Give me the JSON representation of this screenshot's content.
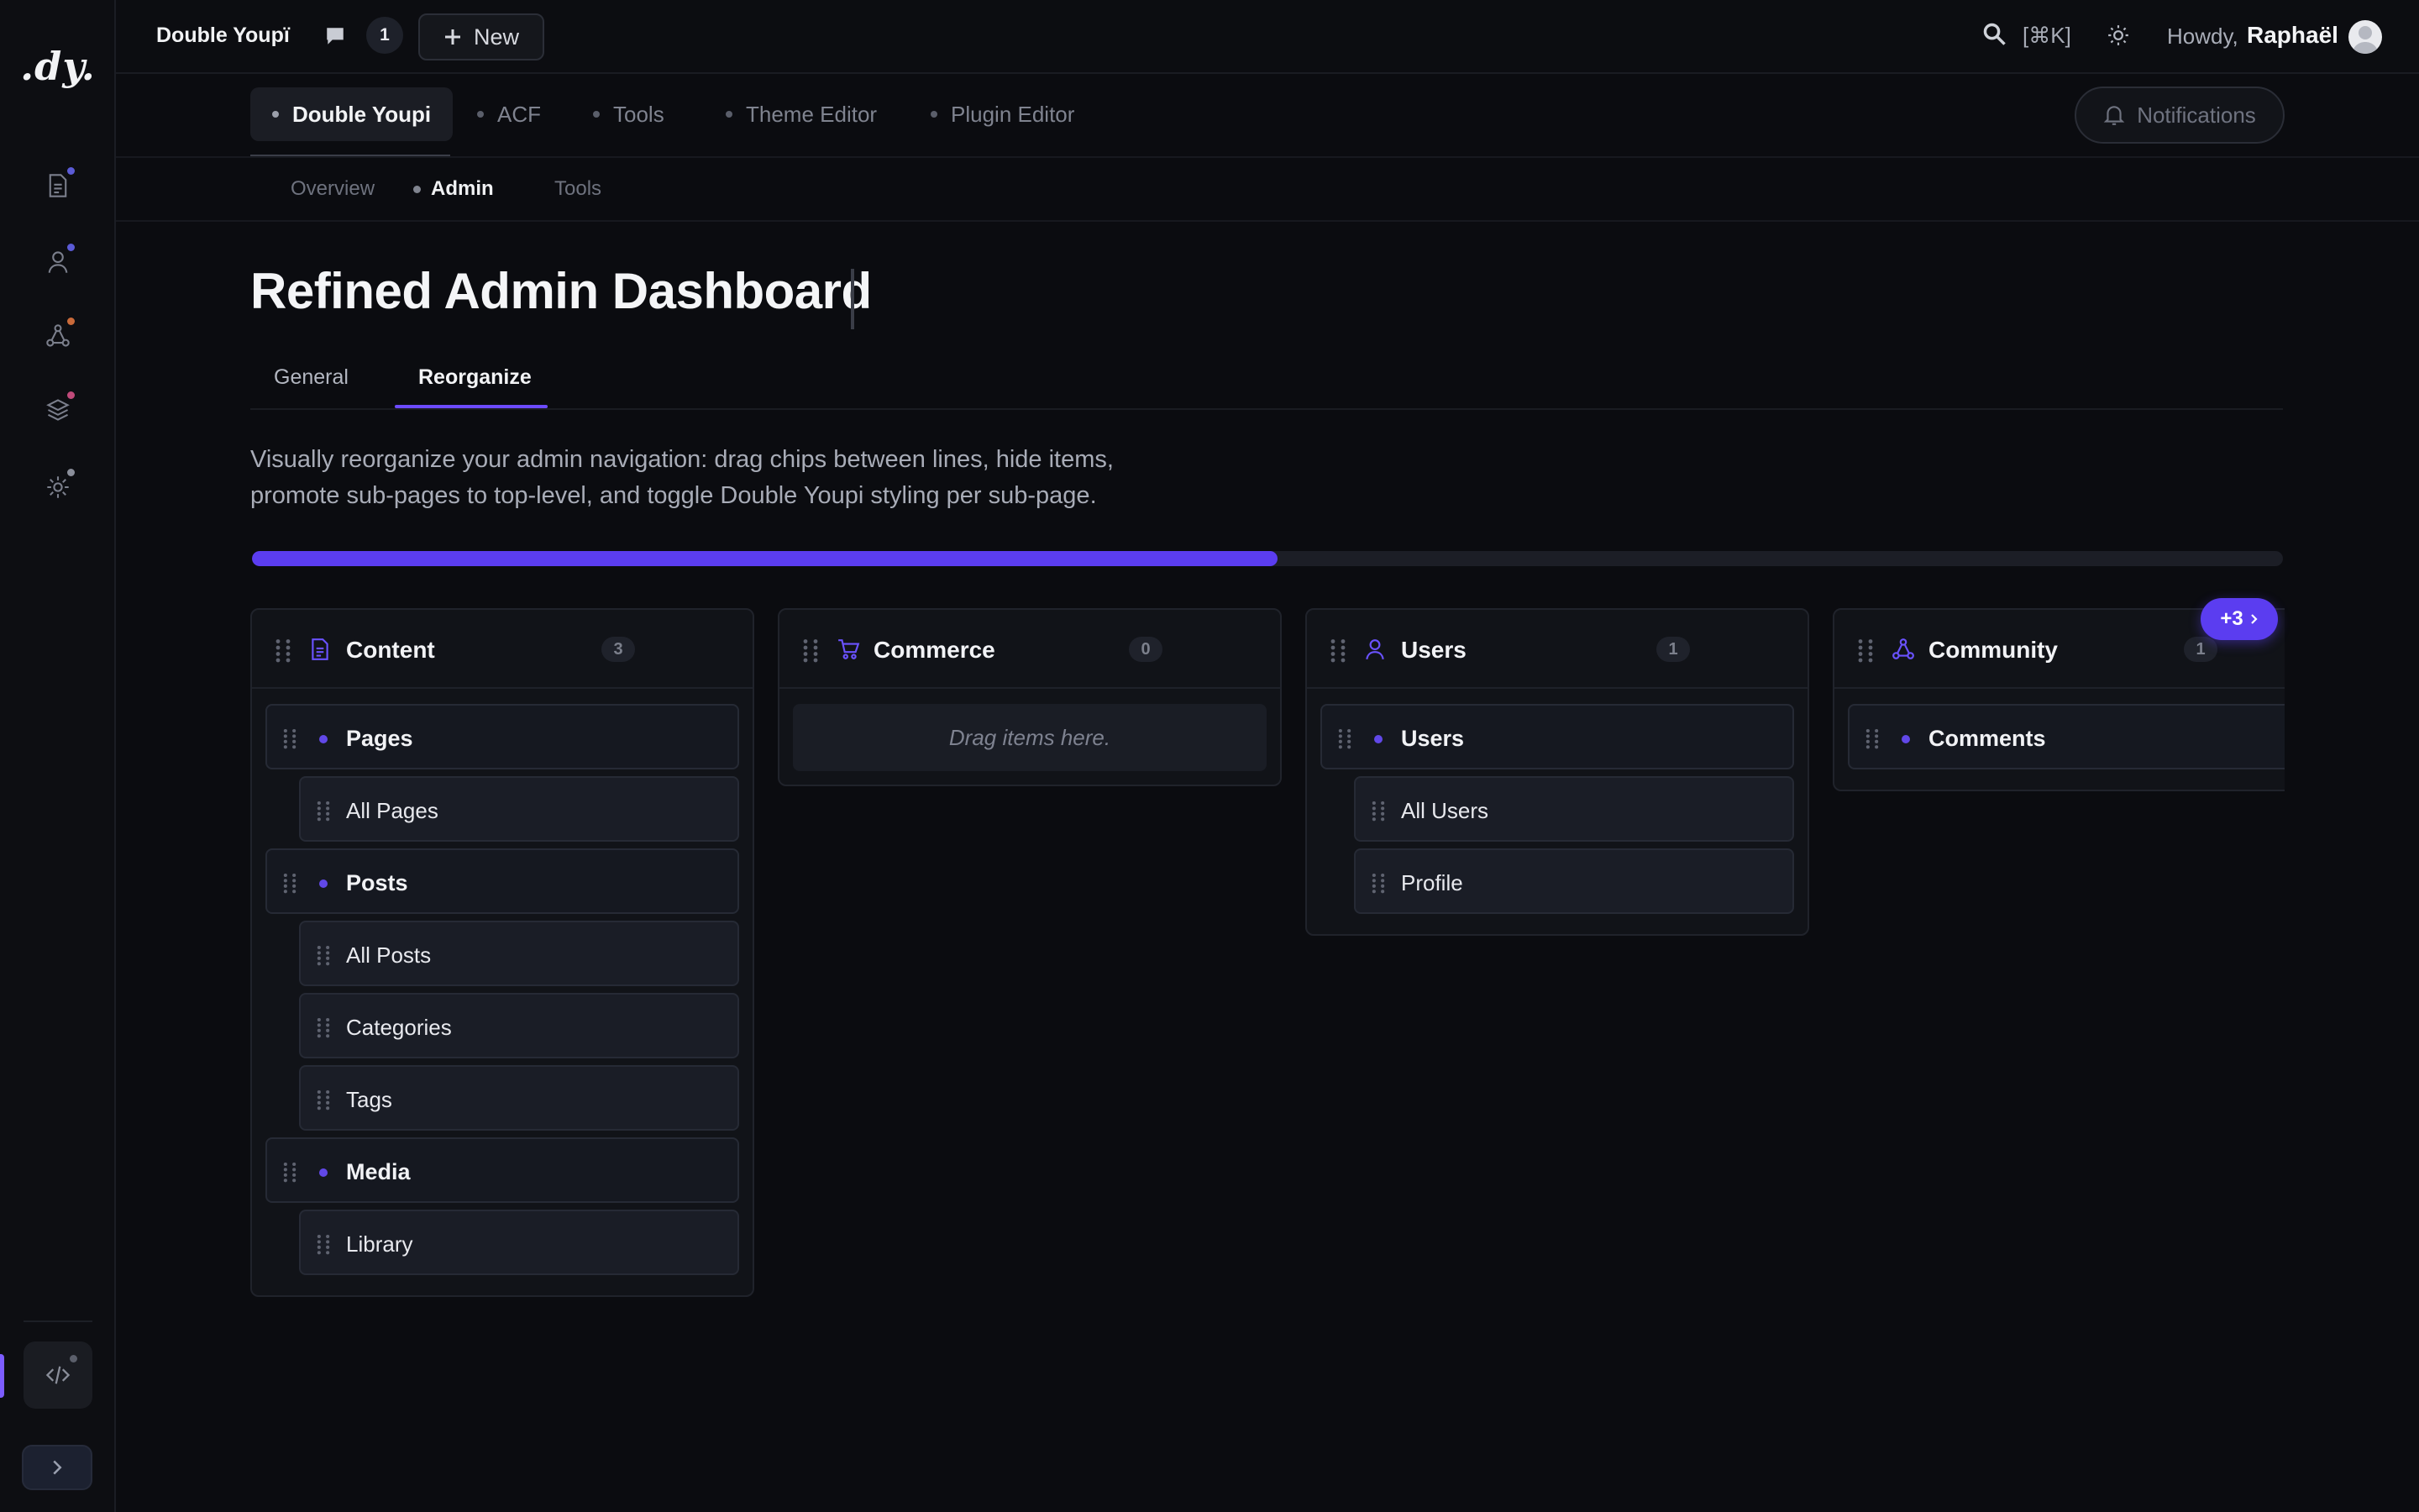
{
  "app": {
    "logo_text": ".dy.",
    "site_name": "Double Youpï",
    "comment_count": "1",
    "new_label": "New",
    "search_shortcut": "[⌘K]",
    "howdy_label": "Howdy,",
    "user_name": "Raphaël"
  },
  "rail": {
    "items": [
      {
        "icon": "page-icon",
        "dot_color": "#5b5bd6"
      },
      {
        "icon": "user-icon",
        "dot_color": "#5b5bd6"
      },
      {
        "icon": "share-nodes-icon",
        "dot_color": "#c96a3a"
      },
      {
        "icon": "layers-icon",
        "dot_color": "#c04a7a"
      },
      {
        "icon": "gear-icon",
        "dot_color": "#8a8e9a"
      }
    ]
  },
  "plugin_tabs": [
    {
      "label": "Double Youpi",
      "active": true
    },
    {
      "label": "ACF",
      "active": false
    },
    {
      "label": "Tools",
      "active": false
    },
    {
      "label": "Theme Editor",
      "active": false
    },
    {
      "label": "Plugin Editor",
      "active": false
    }
  ],
  "notifications_label": "Notifications",
  "sub_tabs": [
    {
      "label": "Overview",
      "active": false
    },
    {
      "label": "Admin",
      "active": true
    },
    {
      "label": "Tools",
      "active": false
    }
  ],
  "page": {
    "title": "Refined Admin Dashboard",
    "tabs": [
      {
        "label": "General",
        "active": false
      },
      {
        "label": "Reorganize",
        "active": true
      }
    ],
    "description": "Visually reorganize your admin navigation: drag chips between lines, hide items, promote sub-pages to top-level, and toggle Double Youpi styling per sub-page.",
    "progress": 0.505
  },
  "colors": {
    "accent": "#5b3df0",
    "background": "#0b0c10",
    "panel": "#111318"
  },
  "columns": [
    {
      "title": "Content",
      "icon": "document-icon",
      "count": "3",
      "groups": [
        {
          "label": "Pages",
          "children": [
            "All Pages"
          ]
        },
        {
          "label": "Posts",
          "children": [
            "All Posts",
            "Categories",
            "Tags"
          ]
        },
        {
          "label": "Media",
          "children": [
            "Library"
          ]
        }
      ]
    },
    {
      "title": "Commerce",
      "icon": "cart-icon",
      "count": "0",
      "empty_text": "Drag items here."
    },
    {
      "title": "Users",
      "icon": "user-icon",
      "count": "1",
      "groups": [
        {
          "label": "Users",
          "children": [
            "All Users",
            "Profile"
          ]
        }
      ]
    },
    {
      "title": "Community",
      "icon": "share-nodes-icon",
      "count": "1",
      "groups": [
        {
          "label": "Comments",
          "children": []
        }
      ]
    }
  ],
  "more_badge": "+3"
}
